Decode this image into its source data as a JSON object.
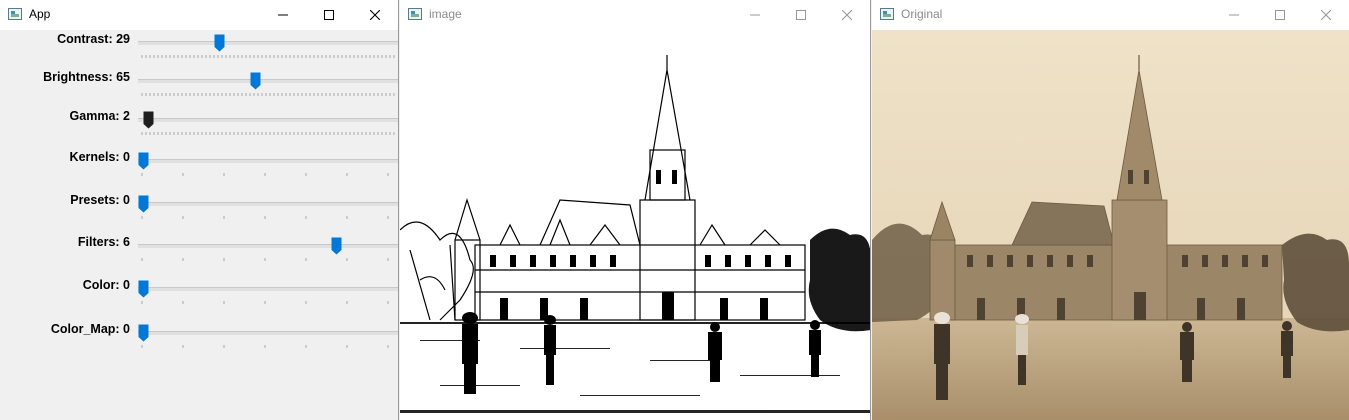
{
  "windows": {
    "app": {
      "title": "App",
      "icon": "app-window-icon"
    },
    "image": {
      "title": "image",
      "icon": "image-window-icon"
    },
    "original": {
      "title": "Original",
      "icon": "original-window-icon"
    }
  },
  "trackbars": [
    {
      "label": "Contrast: 29",
      "position_pct": 31
    },
    {
      "label": "Brightness: 65",
      "position_pct": 45
    },
    {
      "label": "Gamma: 2",
      "position_pct": 4,
      "focused": true
    },
    {
      "label": "Kernels: 0",
      "position_pct": 2
    },
    {
      "label": "Presets: 0",
      "position_pct": 2
    },
    {
      "label": "Filters: 6",
      "position_pct": 76
    },
    {
      "label": "Color: 0",
      "position_pct": 2
    },
    {
      "label": "Color_Map: 0",
      "position_pct": 2
    }
  ],
  "colors": {
    "thumb": "#0078d7",
    "thumb_focused": "#1e1e1e"
  },
  "icons": [
    "minimize-icon",
    "maximize-icon",
    "close-icon"
  ]
}
